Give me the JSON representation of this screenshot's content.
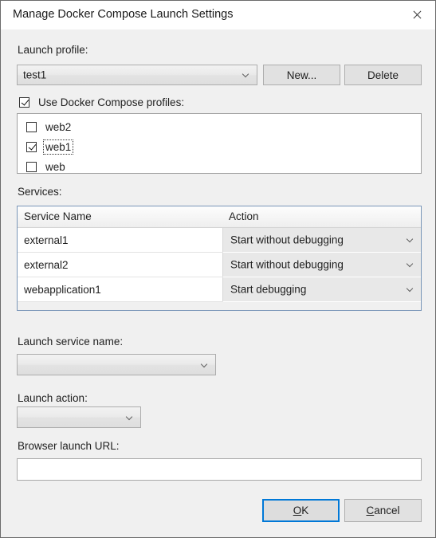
{
  "window": {
    "title": "Manage Docker Compose Launch Settings",
    "close_icon": "close-icon"
  },
  "launch_profile": {
    "label": "Launch profile:",
    "selected": "test1",
    "new_button": "New...",
    "delete_button": "Delete"
  },
  "compose_profiles": {
    "checkbox_label": "Use Docker Compose profiles:",
    "checkbox_checked": true,
    "items": [
      {
        "label": "web2",
        "checked": false,
        "focused": false
      },
      {
        "label": "web1",
        "checked": true,
        "focused": true
      },
      {
        "label": "web",
        "checked": false,
        "focused": false
      }
    ]
  },
  "services": {
    "label": "Services:",
    "columns": [
      "Service Name",
      "Action"
    ],
    "rows": [
      {
        "name": "external1",
        "action": "Start without debugging"
      },
      {
        "name": "external2",
        "action": "Start without debugging"
      },
      {
        "name": "webapplication1",
        "action": "Start debugging"
      }
    ]
  },
  "launch_service_name": {
    "label": "Launch service name:",
    "value": ""
  },
  "launch_action": {
    "label": "Launch action:",
    "value": ""
  },
  "browser_launch_url": {
    "label": "Browser launch URL:",
    "value": "",
    "placeholder": ""
  },
  "footer": {
    "ok": {
      "mnemonic": "O",
      "rest": "K"
    },
    "cancel": {
      "mnemonic": "C",
      "rest": "ancel"
    }
  },
  "colors": {
    "dialog_background": "#f0f0f0",
    "titlebar_background": "#ffffff",
    "accent": "#0078d7",
    "grid_border": "#7a96b8",
    "action_cell": "#e8e8e8"
  }
}
